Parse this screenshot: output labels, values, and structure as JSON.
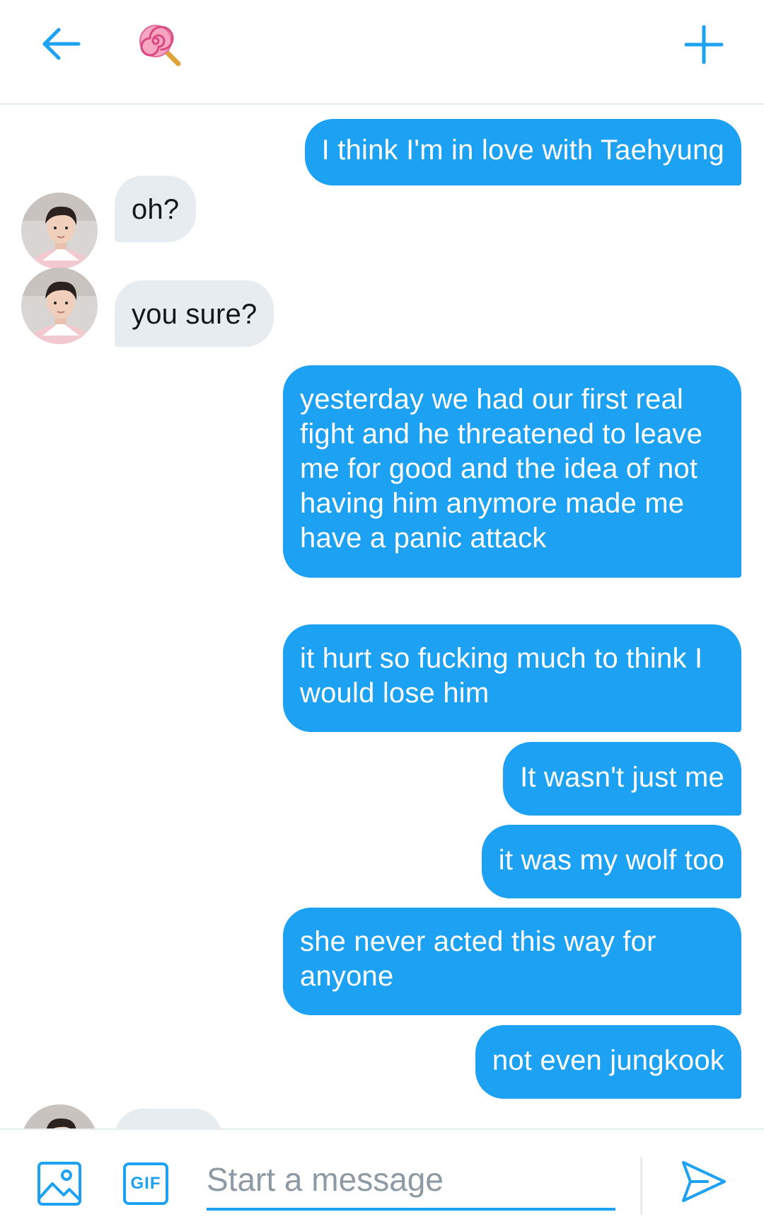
{
  "header": {
    "back_icon": "arrow-left-icon",
    "conversation_avatar_icon": "lollipop-emoji",
    "new_icon": "plus-icon",
    "accent": "#1da1f2"
  },
  "messages": [
    {
      "direction": "sent",
      "text": "I think I'm in love with Taehyung"
    },
    {
      "direction": "received",
      "text": "oh?"
    },
    {
      "direction": "received",
      "text": "you sure?"
    },
    {
      "direction": "sent",
      "text": "yesterday we had our first real\nfight and he threatened to leave\nme for good and the idea of not\nhaving him anymore made me\nhave a panic attack"
    },
    {
      "direction": "sent",
      "text": "it hurt so fucking much to think I\nwould lose him"
    },
    {
      "direction": "sent",
      "text": "It wasn't just me"
    },
    {
      "direction": "sent",
      "text": "it was my wolf too"
    },
    {
      "direction": "sent",
      "text": "she never acted this way for\nanyone"
    },
    {
      "direction": "sent",
      "text": "not even jungkook"
    },
    {
      "direction": "received",
      "text": ""
    }
  ],
  "composer": {
    "placeholder": "Start a message",
    "gif_label": "GIF",
    "media_icon": "image-icon",
    "send_icon": "send-icon"
  },
  "colors": {
    "sent_bubble": "#1da1f2",
    "received_bubble": "#e6ecf0",
    "placeholder": "#8d99a3"
  }
}
